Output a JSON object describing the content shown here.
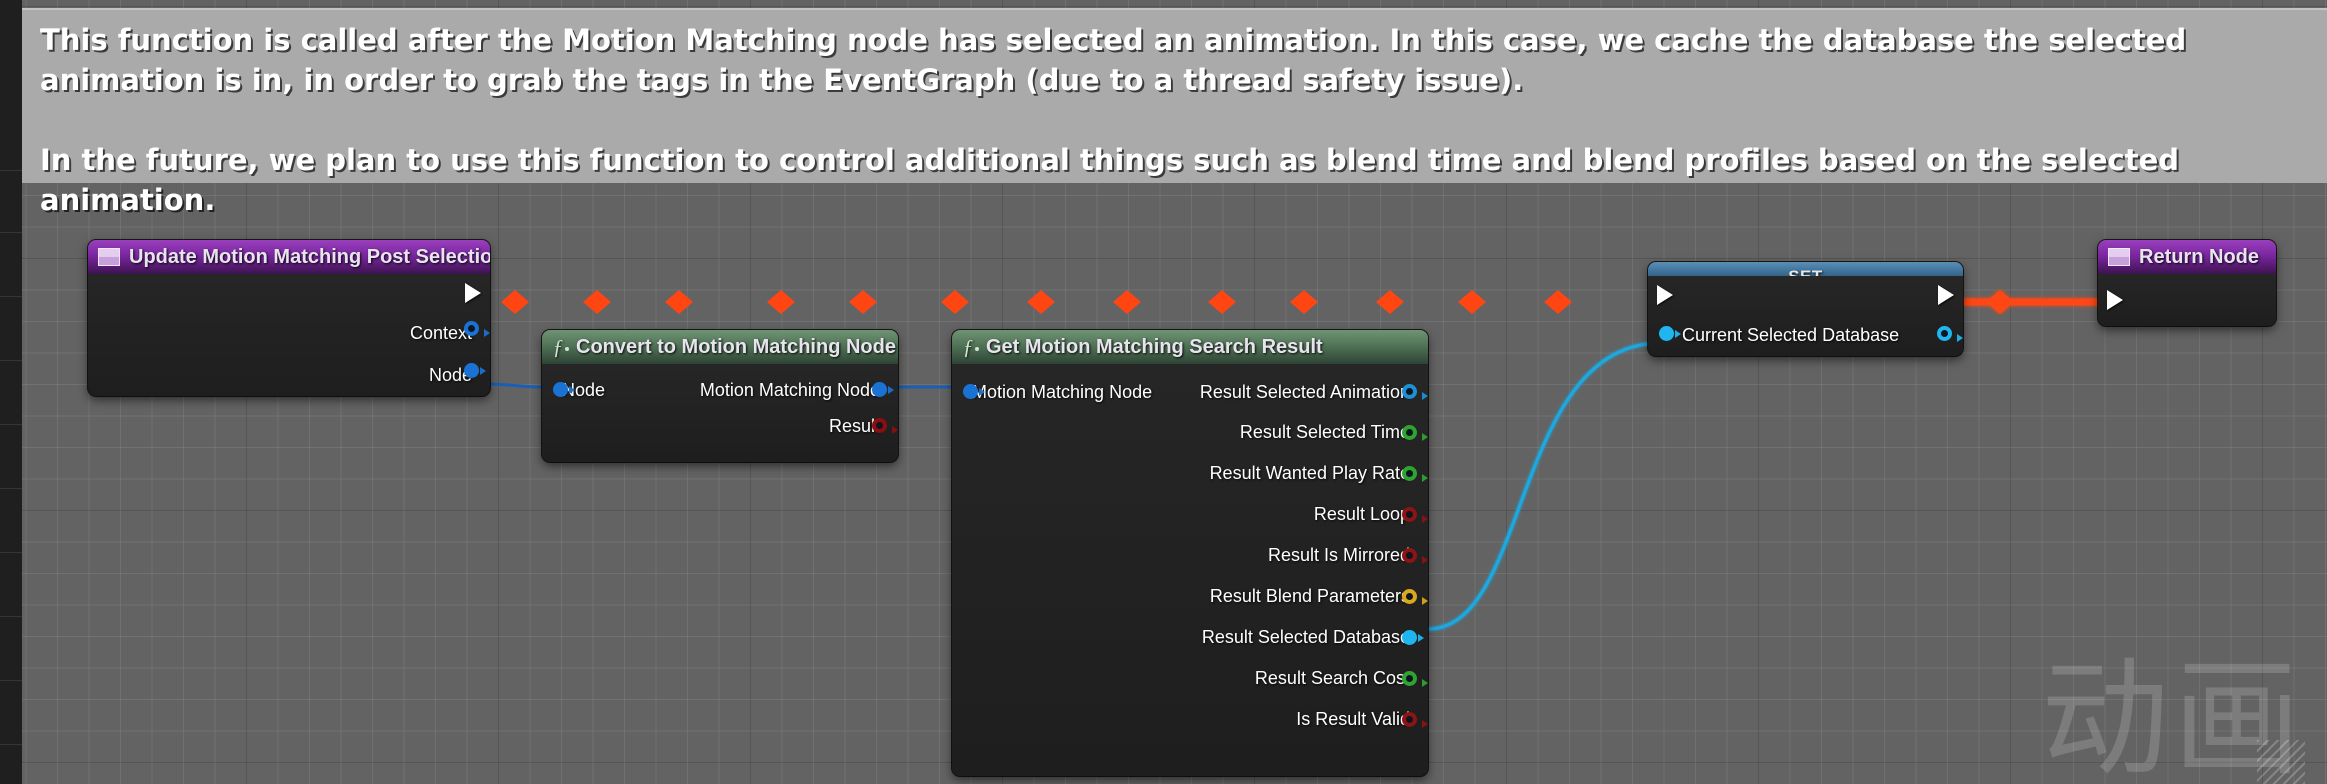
{
  "app": {
    "context": "Unreal Engine Blueprint Graph",
    "background_color": "#636363",
    "watermark": "动画"
  },
  "comment": {
    "name": "blueprint-comment",
    "background_color": "#aaaaaa",
    "text": "This function is called after the Motion Matching node has selected an animation. In this case, we cache the database the selected animation is in, in order to grab the tags in the EventGraph (due to a thread safety issue).\n\nIn the future, we plan to use this function to control additional things such as blend time and blend profiles based on the selected animation."
  },
  "nodes": [
    {
      "id": "update-motion-matching-post-selection",
      "title": "Update Motion Matching Post Selection",
      "kind": "event",
      "header_color": "#7a27a0",
      "icon": "event-node-icon",
      "inputs": [],
      "outputs": [
        {
          "label": "",
          "type": "exec",
          "color": "#ffffff"
        },
        {
          "label": "Context",
          "type": "object",
          "color": "#1a73d4",
          "style": "hollow"
        },
        {
          "label": "Node",
          "type": "object",
          "color": "#1a73d4",
          "style": "filled"
        }
      ]
    },
    {
      "id": "convert-to-motion-matching-node",
      "title": "Convert to Motion Matching Node",
      "kind": "function",
      "header_color": "#4e6f54",
      "icon": "function-icon",
      "inputs": [
        {
          "label": "Node",
          "type": "object",
          "color": "#1a73d4",
          "style": "filled"
        }
      ],
      "outputs": [
        {
          "label": "Motion Matching Node",
          "type": "object",
          "color": "#1a73d4",
          "style": "filled"
        },
        {
          "label": "Result",
          "type": "boolean",
          "color": "#8c0f0f",
          "style": "hollow"
        }
      ]
    },
    {
      "id": "get-motion-matching-search-result",
      "title": "Get Motion Matching Search Result",
      "kind": "function",
      "header_color": "#4e6f54",
      "icon": "function-icon",
      "inputs": [
        {
          "label": "Motion Matching Node",
          "type": "object",
          "color": "#1a73d4",
          "style": "filled"
        }
      ],
      "outputs": [
        {
          "label": "Result Selected Animation",
          "type": "object",
          "color": "#1f8fd4",
          "style": "hollow"
        },
        {
          "label": "Result Selected Time",
          "type": "float",
          "color": "#2fa32f",
          "style": "hollow"
        },
        {
          "label": "Result Wanted Play Rate",
          "type": "float",
          "color": "#2fa32f",
          "style": "hollow"
        },
        {
          "label": "Result Loop",
          "type": "boolean",
          "color": "#8c1414",
          "style": "hollow"
        },
        {
          "label": "Result Is Mirrored",
          "type": "boolean",
          "color": "#8c1414",
          "style": "hollow"
        },
        {
          "label": "Result Blend Parameters",
          "type": "vector",
          "color": "#d9a81c",
          "style": "hollow"
        },
        {
          "label": "Result Selected Database",
          "type": "object",
          "color": "#1fb6ef",
          "style": "filled"
        },
        {
          "label": "Result Search Cost",
          "type": "float",
          "color": "#2fa32f",
          "style": "hollow"
        },
        {
          "label": "Is Result Valid",
          "type": "boolean",
          "color": "#8c1414",
          "style": "hollow"
        }
      ]
    },
    {
      "id": "set-current-selected-database",
      "title": "SET",
      "kind": "set",
      "header_color": "#3b6f97",
      "inputs": [
        {
          "label": "",
          "type": "exec",
          "color": "#ffffff"
        },
        {
          "label": "Current Selected Database",
          "type": "object",
          "color": "#1fb6ef",
          "style": "filled"
        }
      ],
      "outputs": [
        {
          "label": "",
          "type": "exec",
          "color": "#ffffff"
        },
        {
          "label": "",
          "type": "object",
          "color": "#1fb6ef",
          "style": "hollow"
        }
      ]
    },
    {
      "id": "return-node",
      "title": "Return Node",
      "kind": "event",
      "header_color": "#7a27a0",
      "icon": "event-node-icon",
      "inputs": [
        {
          "label": "",
          "type": "exec",
          "color": "#ffffff"
        }
      ],
      "outputs": []
    }
  ],
  "wires": [
    {
      "from": "update-motion-matching-post-selection.exec",
      "to": "set-current-selected-database.exec",
      "type": "exec",
      "color": "#ff4612"
    },
    {
      "from": "set-current-selected-database.exec-out",
      "to": "return-node.exec",
      "type": "exec",
      "color": "#ff4612"
    },
    {
      "from": "update-motion-matching-post-selection.Node",
      "to": "convert-to-motion-matching-node.Node",
      "type": "data",
      "color": "#1a73d4"
    },
    {
      "from": "convert-to-motion-matching-node.Motion Matching Node",
      "to": "get-motion-matching-search-result.Motion Matching Node",
      "type": "data",
      "color": "#1a73d4"
    },
    {
      "from": "get-motion-matching-search-result.Result Selected Database",
      "to": "set-current-selected-database.Current Selected Database",
      "type": "data",
      "color": "#1fb6ef"
    }
  ]
}
